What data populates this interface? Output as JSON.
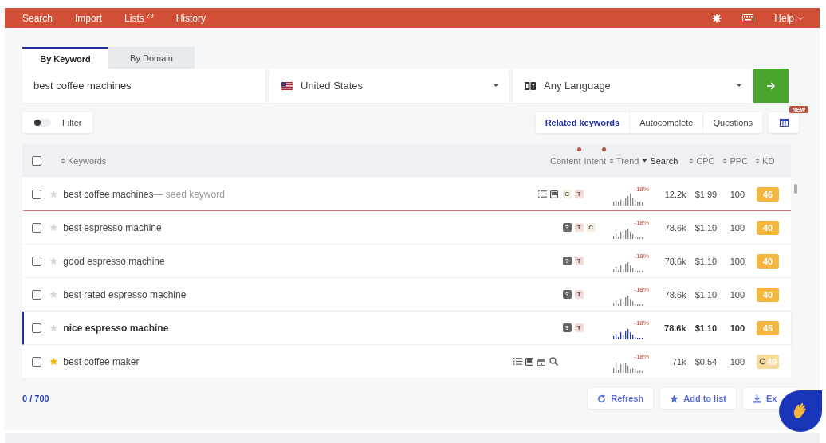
{
  "nav": {
    "items": [
      {
        "label": "Search"
      },
      {
        "label": "Import"
      },
      {
        "label": "Lists",
        "count": "79"
      },
      {
        "label": "History"
      }
    ],
    "help": "Help"
  },
  "mode_tabs": [
    {
      "label": "By Keyword",
      "selected": true
    },
    {
      "label": "By Domain",
      "selected": false
    }
  ],
  "search": {
    "query": "best coffee machines",
    "country": "United States",
    "language": "Any Language"
  },
  "filter": {
    "label": "Filter",
    "on": false
  },
  "result_tabs": [
    {
      "label": "Related keywords",
      "selected": true
    },
    {
      "label": "Autocomplete",
      "selected": false
    },
    {
      "label": "Questions",
      "selected": false
    }
  ],
  "columns_badge": "NEW",
  "table": {
    "select_all": {
      "checked": false
    },
    "columns": [
      {
        "label": "Keywords",
        "kind": "sortable",
        "selected": false,
        "new": false
      },
      {
        "label": "Content",
        "kind": "plain",
        "selected": false,
        "new": true
      },
      {
        "label": "Intent",
        "kind": "plain",
        "selected": false,
        "new": true
      },
      {
        "label": "Trend",
        "kind": "sortable",
        "selected": false,
        "new": false
      },
      {
        "label": "Search",
        "kind": "sortable",
        "selected": true,
        "new": false
      },
      {
        "label": "CPC",
        "kind": "sortable",
        "selected": false,
        "new": false
      },
      {
        "label": "PPC",
        "kind": "sortable",
        "selected": false,
        "new": false
      },
      {
        "label": "KD",
        "kind": "sortable",
        "selected": false,
        "new": false
      }
    ],
    "rows": [
      {
        "keyword": "best coffee machines",
        "note": "— seed keyword",
        "kind": "seed",
        "checked": false,
        "starred": false,
        "selected": false,
        "content": [
          {
            "kind": "list"
          },
          {
            "kind": "image"
          }
        ],
        "intent": [
          {
            "label": "C",
            "kind": "commercial"
          },
          {
            "label": "T",
            "kind": "transactional"
          }
        ],
        "trend": "-18%",
        "search": "12.2k",
        "cpc": "$1.99",
        "ppc": "100",
        "kd": "46",
        "refreshing": false
      },
      {
        "keyword": "best espresso machine",
        "kind": "normal",
        "checked": false,
        "starred": false,
        "selected": false,
        "intent": [
          {
            "label": "?",
            "kind": "informational"
          },
          {
            "label": "T",
            "kind": "transactional"
          },
          {
            "label": "C",
            "kind": "commercial"
          }
        ],
        "trend": "-18%",
        "search": "78.6k",
        "cpc": "$1.10",
        "ppc": "100",
        "kd": "40",
        "refreshing": false
      },
      {
        "keyword": "good espresso machine",
        "kind": "normal",
        "checked": false,
        "starred": false,
        "selected": false,
        "intent": [
          {
            "label": "?",
            "kind": "informational"
          },
          {
            "label": "T",
            "kind": "transactional"
          }
        ],
        "trend": "-18%",
        "search": "78.6k",
        "cpc": "$1.10",
        "ppc": "100",
        "kd": "40",
        "refreshing": false
      },
      {
        "keyword": "best rated espresso machine",
        "kind": "normal",
        "checked": false,
        "starred": false,
        "selected": false,
        "intent": [
          {
            "label": "?",
            "kind": "informational"
          },
          {
            "label": "T",
            "kind": "transactional"
          }
        ],
        "trend": "-18%",
        "search": "78.6k",
        "cpc": "$1.10",
        "ppc": "100",
        "kd": "40",
        "refreshing": false
      },
      {
        "keyword": "nice espresso machine",
        "kind": "normal",
        "checked": false,
        "starred": false,
        "selected": true,
        "intent": [
          {
            "label": "?",
            "kind": "informational"
          },
          {
            "label": "T",
            "kind": "transactional"
          }
        ],
        "trend": "-18%",
        "search": "78.6k",
        "cpc": "$1.10",
        "ppc": "100",
        "kd": "45",
        "refreshing": false
      },
      {
        "keyword": "best coffee maker",
        "kind": "normal",
        "checked": false,
        "starred": true,
        "selected": false,
        "content": [
          {
            "kind": "list"
          },
          {
            "kind": "image"
          },
          {
            "kind": "shop"
          },
          {
            "kind": "search"
          }
        ],
        "trend": "-18%",
        "search": "71k",
        "cpc": "$0.54",
        "ppc": "100",
        "kd": "49",
        "refreshing": true
      }
    ]
  },
  "footer": {
    "count": "0 / 700",
    "buttons": [
      {
        "label": "Refresh",
        "kind": "refresh"
      },
      {
        "label": "Add to list",
        "kind": "add"
      },
      {
        "label": "Ex",
        "kind": "export"
      }
    ]
  }
}
